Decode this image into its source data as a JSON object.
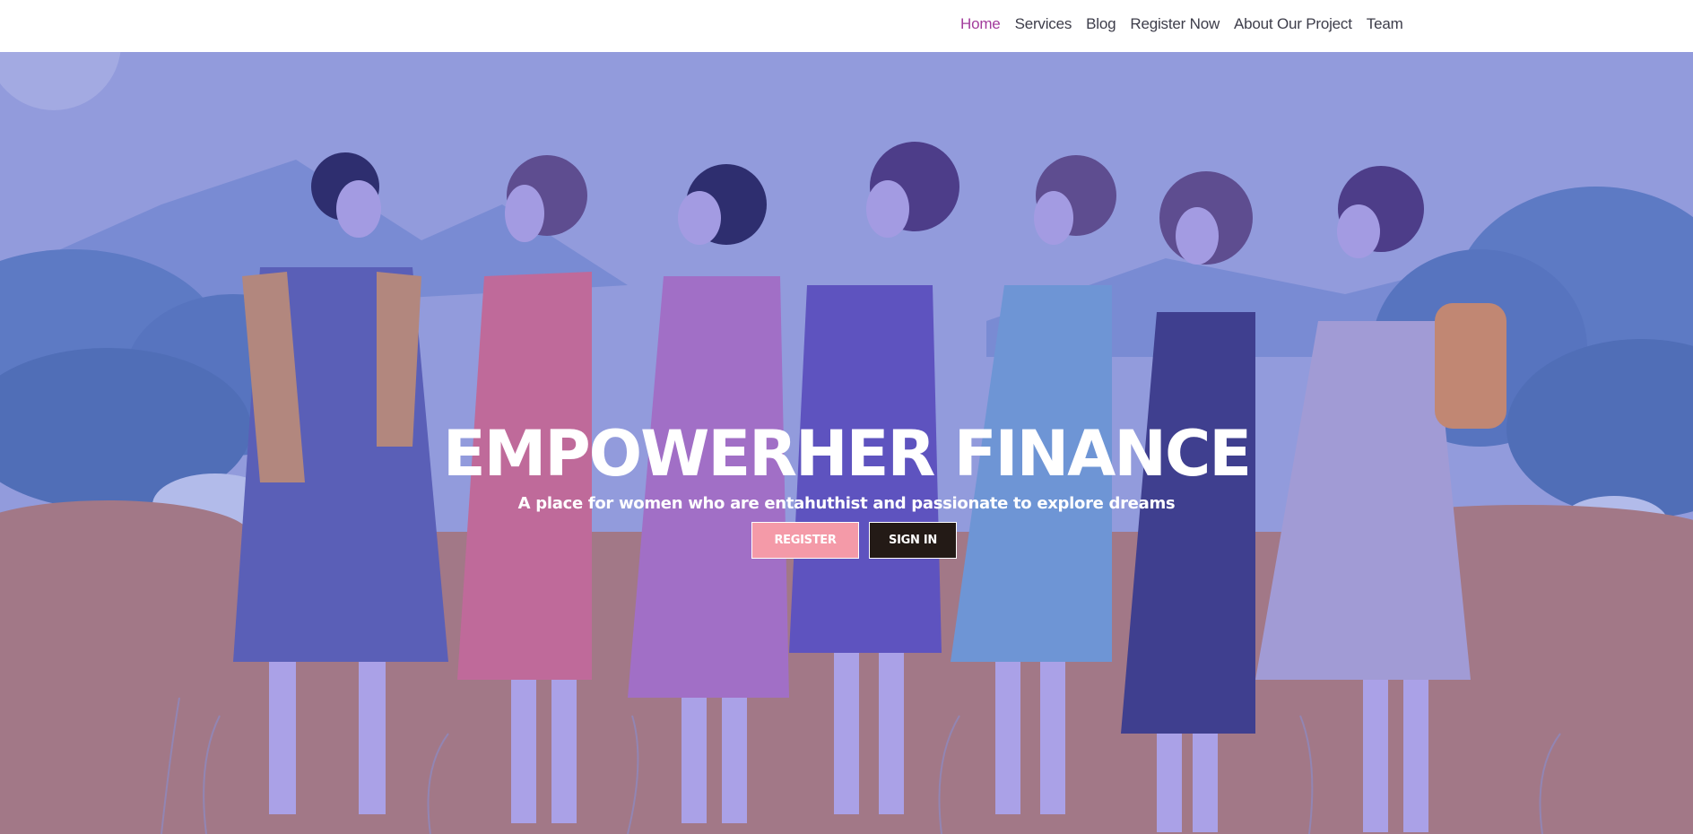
{
  "nav": {
    "items": [
      {
        "label": "Home",
        "active": true
      },
      {
        "label": "Services",
        "active": false
      },
      {
        "label": "Blog",
        "active": false
      },
      {
        "label": "Register Now",
        "active": false
      },
      {
        "label": "About Our Project",
        "active": false
      },
      {
        "label": "Team",
        "active": false
      }
    ],
    "active_color": "#a23c9c",
    "text_color": "#3d3d4a"
  },
  "hero": {
    "title": "EMPOWERHER FINANCE",
    "subtitle": "A place for women who are entahuthist and passionate to explore dreams",
    "register_label": "REGISTER",
    "signin_label": "SIGN IN",
    "image_description_icon": "women-illustration",
    "colors": {
      "sky": "#96a0e0",
      "ground": "#a87a84",
      "register_bg": "#f49aa8",
      "signin_bg": "#231a16"
    }
  }
}
